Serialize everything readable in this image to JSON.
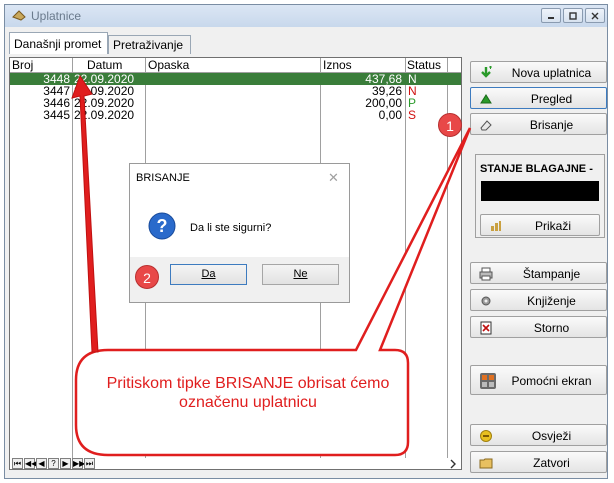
{
  "window": {
    "title": "Uplatnice"
  },
  "tabs": [
    {
      "label": "Današnji promet"
    },
    {
      "label": "Pretraživanje"
    }
  ],
  "grid": {
    "columns": [
      "Broj",
      "Datum",
      "Opaska",
      "Iznos",
      "Status"
    ],
    "rows": [
      {
        "broj": "3448",
        "datum": "22.09.2020",
        "opaska": "",
        "iznos": "437,68",
        "status": "N",
        "status_color": "#ffffff"
      },
      {
        "broj": "3447",
        "datum": "22.09.2020",
        "opaska": "",
        "iznos": "39,26",
        "status": "N",
        "status_color": "#d01010"
      },
      {
        "broj": "3446",
        "datum": "22.09.2020",
        "opaska": "",
        "iznos": "200,00",
        "status": "P",
        "status_color": "#2a9a2a"
      },
      {
        "broj": "3445",
        "datum": "22.09.2020",
        "opaska": "",
        "iznos": "0,00",
        "status": "S",
        "status_color": "#d01010"
      }
    ],
    "nav_buttons": [
      "⏮",
      "◀◀",
      "◀",
      "?",
      "▶",
      "▶▶",
      "⏭"
    ]
  },
  "sidebar": {
    "nova_uplatnica": "Nova uplatnica",
    "pregled": "Pregled",
    "brisanje": "Brisanje",
    "stanje_title": "STANJE BLAGAJNE -",
    "prikazi": "Prikaži",
    "stampanje": "Štampanje",
    "knjizenje": "Knjiženje",
    "storno": "Storno",
    "pomocni_ekran": "Pomoćni ekran",
    "osvjezi": "Osvježi",
    "zatvori": "Zatvori"
  },
  "dialog": {
    "title": "BRISANJE",
    "message": "Da li ste sigurni?",
    "yes_label": "Da",
    "no_label": "Ne"
  },
  "annotations": {
    "badge_1": "1",
    "badge_2": "2",
    "callout": "Pritiskom tipke BRISANJE obrisat ćemo označenu uplatnicu",
    "arrow_color": "#e01e1e"
  }
}
